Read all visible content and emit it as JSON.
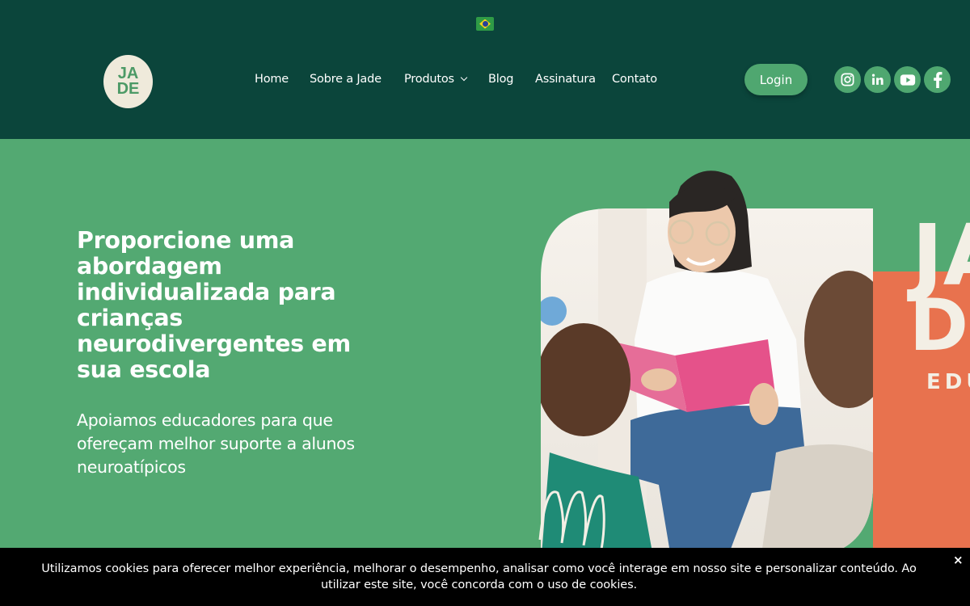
{
  "header": {
    "logo_line1": "JA",
    "logo_line2": "DE",
    "nav": [
      {
        "label": "Home"
      },
      {
        "label": "Sobre a Jade"
      },
      {
        "label": "Produtos"
      },
      {
        "label": "Blog"
      },
      {
        "label": "Assinatura"
      },
      {
        "label": "Contato"
      }
    ],
    "login_label": "Login",
    "social_icons": [
      "instagram-icon",
      "linkedin-icon",
      "youtube-icon",
      "facebook-icon"
    ]
  },
  "hero": {
    "title": "Proporcione uma abordagem individualizada para crianças neurodivergentes em sua escola",
    "subtitle": "Apoiamos educadores para que ofereçam melhor suporte a alunos neuroatípicos",
    "side_logo_line1": "JA",
    "side_logo_line2": "DE",
    "side_logo_tag": "EDU"
  },
  "cookie": {
    "text": "Utilizamos cookies para oferecer melhor experiência, melhorar o desempenho, analisar como você interage em nosso site e personalizar conteúdo. Ao utilizar este site, você concorda com o uso de cookies.",
    "close": "×"
  },
  "colors": {
    "header_bg": "#0b453b",
    "hero_bg": "#53a972",
    "accent_green": "#4fa770",
    "orange": "#e8724e",
    "cream": "#efeadb"
  }
}
